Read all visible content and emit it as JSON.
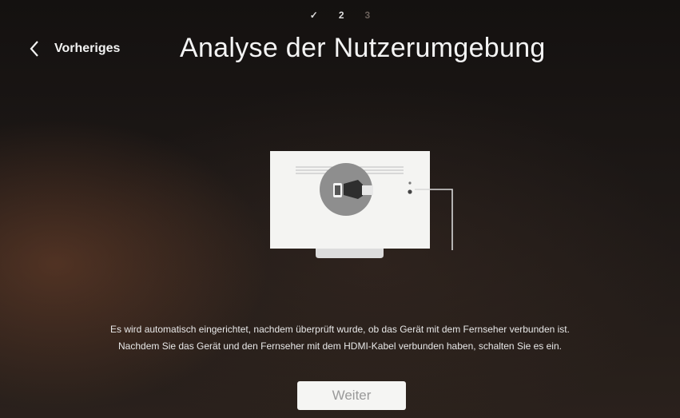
{
  "steps": {
    "step1": "✓",
    "step2": "2",
    "step3": "3"
  },
  "header": {
    "back_label": "Vorheriges",
    "title": "Analyse der Nutzerumgebung"
  },
  "description": {
    "line1": "Es wird automatisch eingerichtet, nachdem überprüft wurde, ob das Gerät mit dem Fernseher verbunden ist.",
    "line2": "Nachdem Sie das Gerät und den Fernseher mit dem HDMI-Kabel verbunden haben, schalten Sie es ein."
  },
  "buttons": {
    "next_label": "Weiter"
  },
  "icons": {
    "back": "chevron-left-icon",
    "illustration": "tv-hdmi-connection-illustration"
  }
}
